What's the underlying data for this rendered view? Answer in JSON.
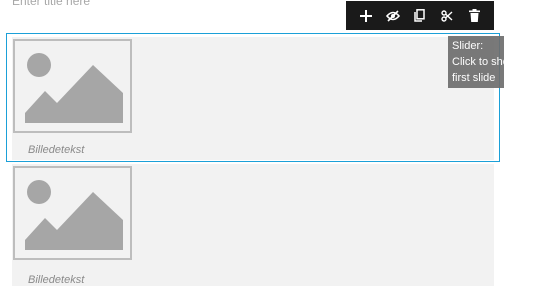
{
  "title_field": {
    "placeholder": "Enter title here"
  },
  "toolbar": {
    "buttons": [
      {
        "icon": "plus-icon",
        "action": "add"
      },
      {
        "icon": "eye-off-icon",
        "action": "hide"
      },
      {
        "icon": "copy-icon",
        "action": "duplicate"
      },
      {
        "icon": "scissors-icon",
        "action": "cut"
      },
      {
        "icon": "trash-icon",
        "action": "delete"
      }
    ]
  },
  "tooltip": {
    "lines": [
      "Slider:",
      "Click to show",
      "first slide"
    ]
  },
  "slides": [
    {
      "caption": "Billedetekst",
      "selected": true
    },
    {
      "caption": "Billedetekst",
      "selected": false
    }
  ],
  "colors": {
    "selection_outline": "#1ba0d8",
    "toolbar_bg": "#1a1a1a",
    "slide_bg": "#f2f2f2",
    "placeholder_shape": "#a6a6a6",
    "tooltip_bg": "#6e6e6e"
  }
}
